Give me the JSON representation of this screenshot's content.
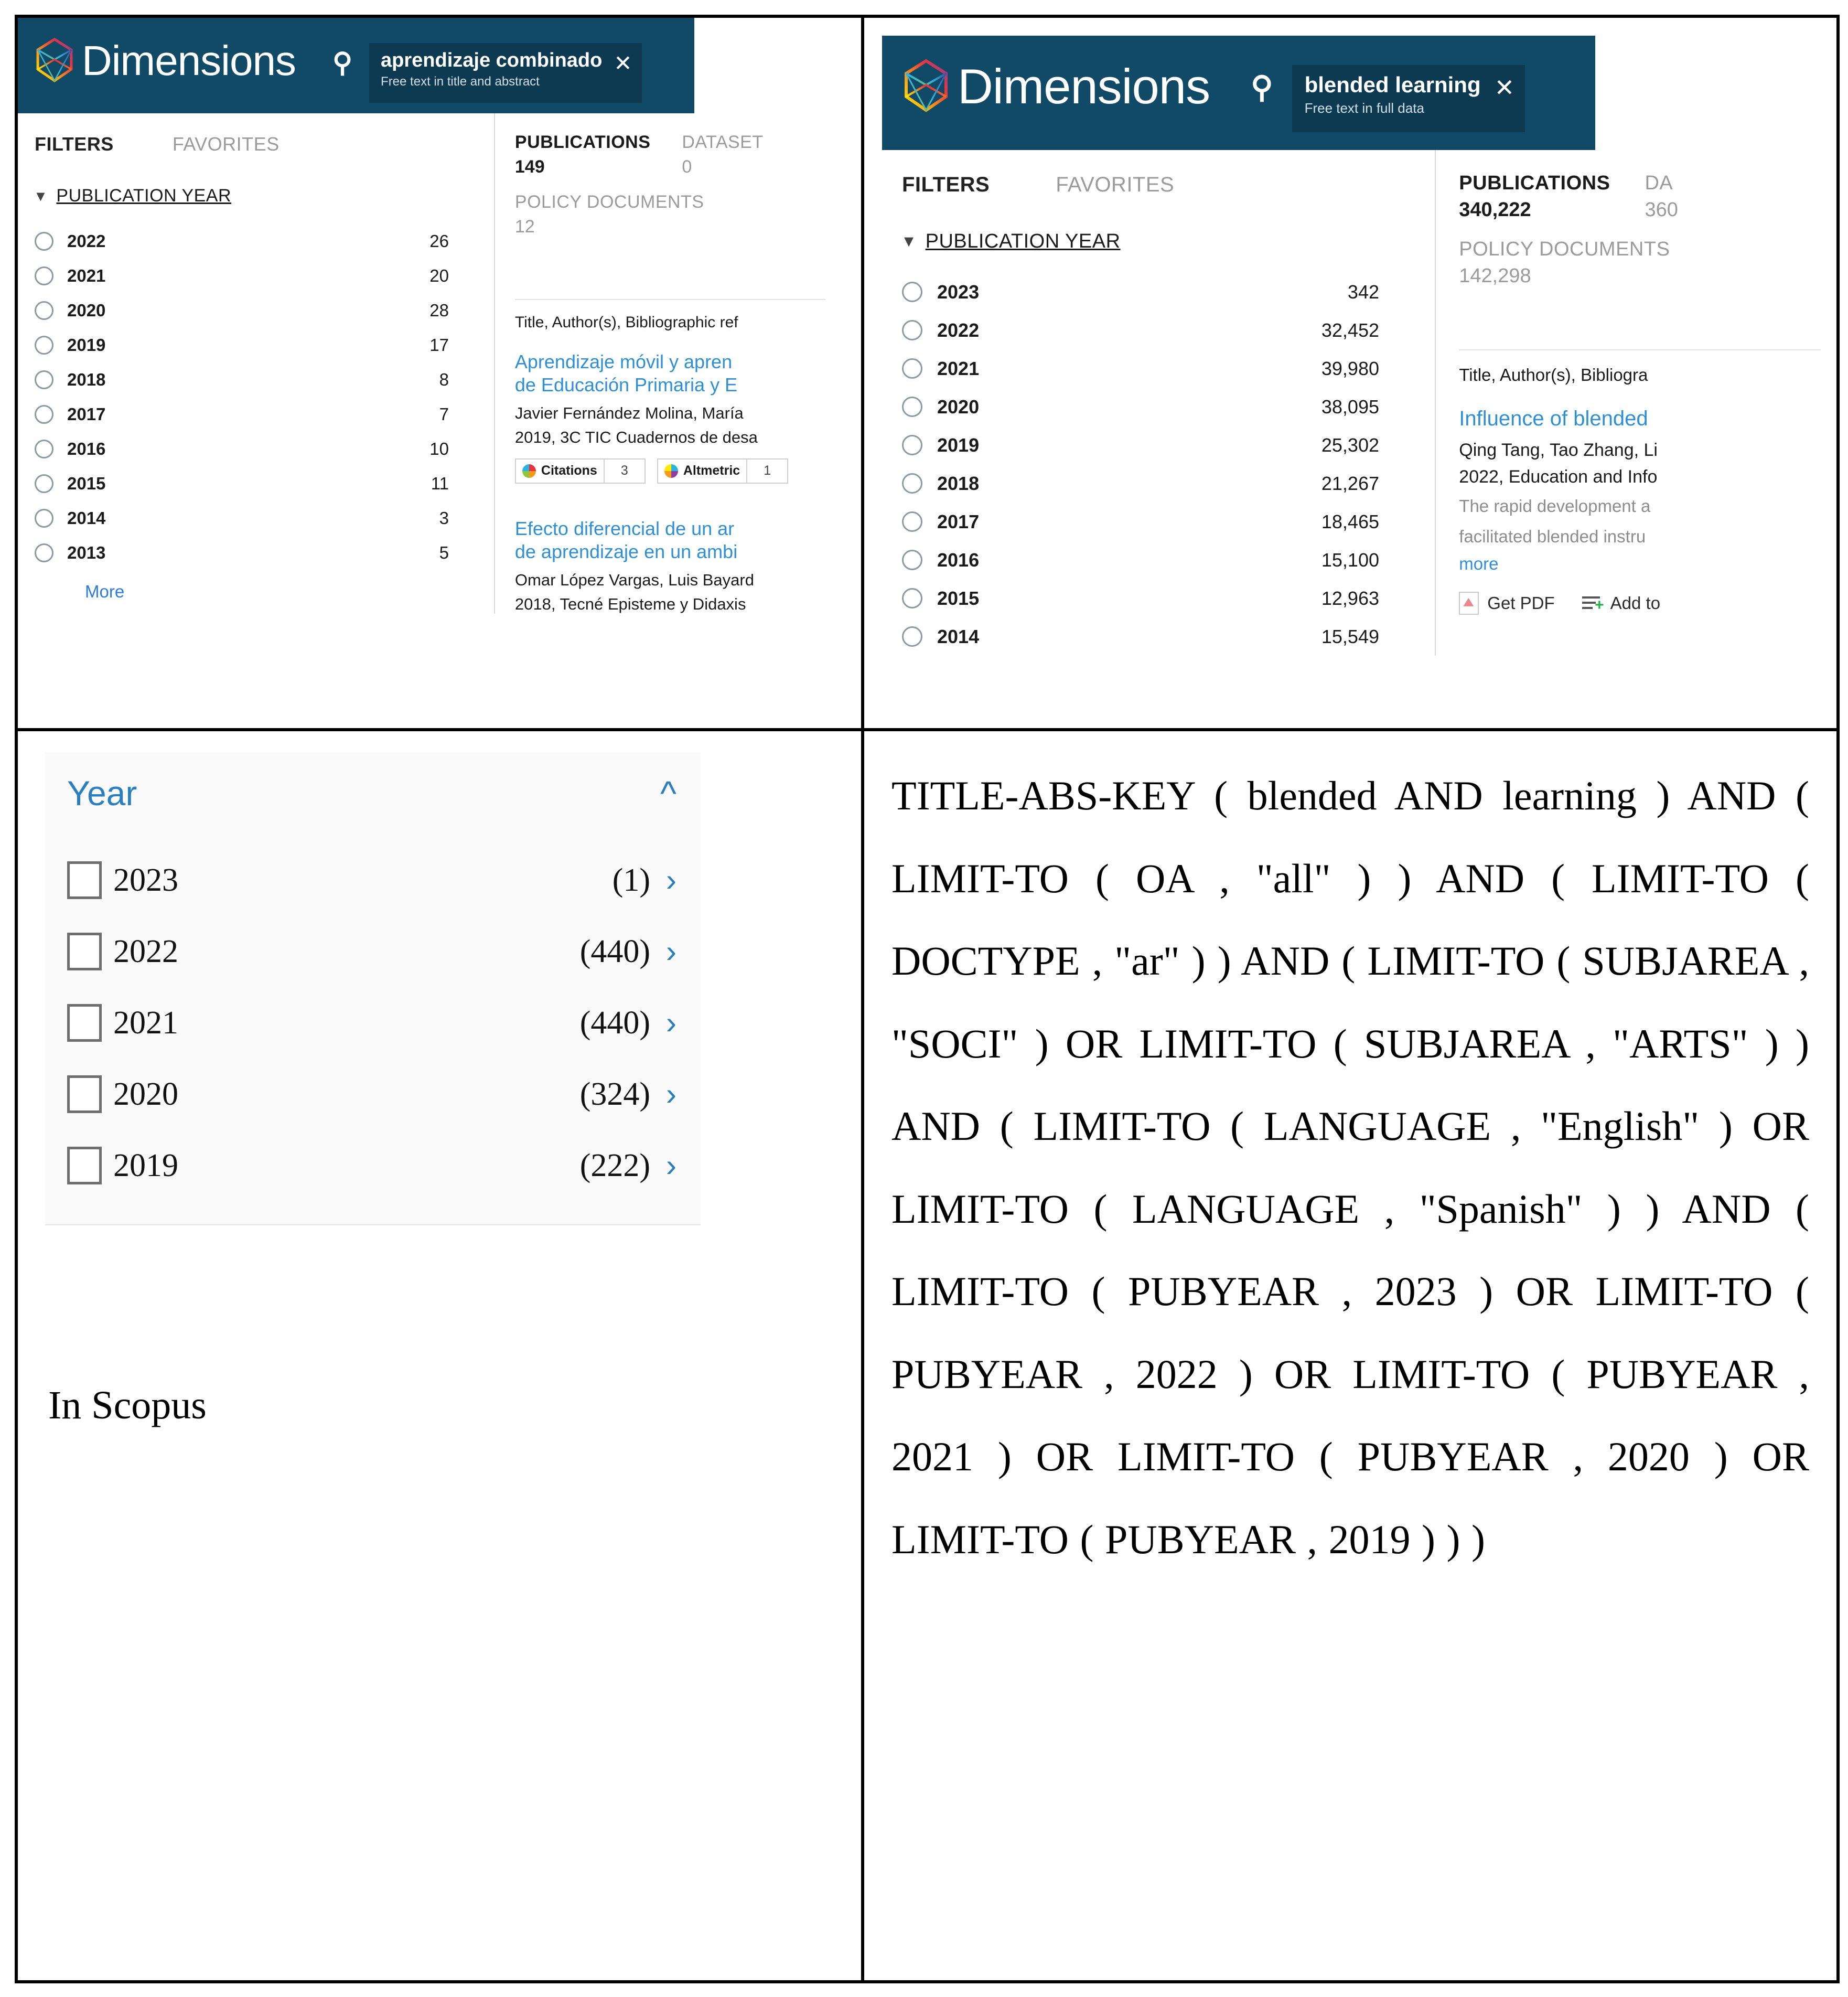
{
  "panels": {
    "dimensions_spanish": {
      "app_name": "Dimensions",
      "logo_icon": "dimensions-polyhedron-logo",
      "search_icon": "search-icon",
      "search_chip": {
        "query": "aprendizaje combinado",
        "scope": "Free text in title and abstract",
        "close_icon": "close-icon"
      },
      "tabs": [
        "FILTERS",
        "FAVORITES"
      ],
      "facet": {
        "chevron_icon": "chevron-down-icon",
        "title": "PUBLICATION YEAR",
        "more_label": "More",
        "rows": [
          {
            "year": "2022",
            "count": "26"
          },
          {
            "year": "2021",
            "count": "20"
          },
          {
            "year": "2020",
            "count": "28"
          },
          {
            "year": "2019",
            "count": "17"
          },
          {
            "year": "2018",
            "count": "8"
          },
          {
            "year": "2017",
            "count": "7"
          },
          {
            "year": "2016",
            "count": "10"
          },
          {
            "year": "2015",
            "count": "11"
          },
          {
            "year": "2014",
            "count": "3"
          },
          {
            "year": "2013",
            "count": "5"
          }
        ]
      },
      "results": {
        "publications_label": "PUBLICATIONS",
        "publications_count": "149",
        "datasets_label": "DATASET",
        "datasets_count": "0",
        "policy_label": "POLICY DOCUMENTS",
        "policy_count": "12",
        "sort_bar": "Title, Author(s), Bibliographic ref",
        "items": [
          {
            "title_line1": "Aprendizaje móvil y apren",
            "title_line2": "de Educación Primaria y E",
            "authors": "Javier Fernández Molina, María",
            "source": "2019, 3C TIC Cuadernos de desa",
            "badges": [
              {
                "label": "Citations",
                "value": "3"
              },
              {
                "label": "Altmetric",
                "value": "1"
              }
            ]
          },
          {
            "title_line1": "Efecto diferencial de un ar",
            "title_line2": "de aprendizaje en un ambi",
            "authors": "Omar López Vargas, Luis Bayard",
            "source": "2018, Tecné Episteme y Didaxis"
          }
        ]
      }
    },
    "dimensions_english": {
      "app_name": "Dimensions",
      "logo_icon": "dimensions-polyhedron-logo",
      "search_icon": "search-icon",
      "search_chip": {
        "query": "blended learning",
        "scope": "Free text in full data",
        "close_icon": "close-icon"
      },
      "tabs": [
        "FILTERS",
        "FAVORITES"
      ],
      "facet": {
        "chevron_icon": "chevron-down-icon",
        "title": "PUBLICATION YEAR",
        "rows": [
          {
            "year": "2023",
            "count": "342"
          },
          {
            "year": "2022",
            "count": "32,452"
          },
          {
            "year": "2021",
            "count": "39,980"
          },
          {
            "year": "2020",
            "count": "38,095"
          },
          {
            "year": "2019",
            "count": "25,302"
          },
          {
            "year": "2018",
            "count": "21,267"
          },
          {
            "year": "2017",
            "count": "18,465"
          },
          {
            "year": "2016",
            "count": "15,100"
          },
          {
            "year": "2015",
            "count": "12,963"
          },
          {
            "year": "2014",
            "count": "15,549"
          }
        ]
      },
      "results": {
        "publications_label": "PUBLICATIONS",
        "publications_count": "340,222",
        "datasets_label": "DA",
        "datasets_count": "360",
        "policy_label": "POLICY DOCUMENTS",
        "policy_count": "142,298",
        "sort_bar": "Title, Author(s), Bibliogra",
        "items": [
          {
            "title_line1": "Influence of blended",
            "authors": "Qing Tang, Tao Zhang, Li",
            "source": "2022, Education and Info",
            "abstract_line1": "The rapid development a",
            "abstract_line2": "facilitated blended instru",
            "more_label": "more",
            "actions": [
              {
                "icon": "pdf-icon",
                "label": "Get PDF"
              },
              {
                "icon": "add-to-library-icon",
                "label": "Add to"
              }
            ]
          }
        ]
      }
    },
    "scopus_facet": {
      "title": "Year",
      "collapse_icon": "chevron-up-icon",
      "caption": "In Scopus",
      "rows": [
        {
          "year": "2023",
          "count": "(1)",
          "arrow_icon": "chevron-right-icon"
        },
        {
          "year": "2022",
          "count": "(440)",
          "arrow_icon": "chevron-right-icon"
        },
        {
          "year": "2021",
          "count": "(440)",
          "arrow_icon": "chevron-right-icon"
        },
        {
          "year": "2020",
          "count": "(324)",
          "arrow_icon": "chevron-right-icon"
        },
        {
          "year": "2019",
          "count": "(222)",
          "arrow_icon": "chevron-right-icon"
        }
      ]
    },
    "scopus_query": {
      "text": "TITLE-ABS-KEY ( blended AND learning ) AND ( LIMIT-TO ( OA , \"all\" ) ) AND ( LIMIT-TO ( DOCTYPE , \"ar\" ) ) AND ( LIMIT-TO ( SUBJAREA , \"SOCI\" ) OR LIMIT-TO ( SUBJAREA , \"ARTS\" ) ) AND ( LIMIT-TO ( LANGUAGE , \"English\" ) OR LIMIT-TO ( LANGUAGE , \"Spanish\" ) ) AND ( LIMIT-TO ( PUBYEAR , 2023 ) OR LIMIT-TO ( PUBYEAR , 2022 ) OR LIMIT-TO ( PUBYEAR , 2021 ) OR LIMIT-TO ( PUBYEAR , 2020 ) OR LIMIT-TO ( PUBYEAR , 2019 ) ) )"
    }
  },
  "colors": {
    "dimensions_header": "#114a66",
    "dimensions_chip": "#0d3a51",
    "link_blue": "#2f8fd4",
    "scopus_blue": "#2a7fc1"
  }
}
